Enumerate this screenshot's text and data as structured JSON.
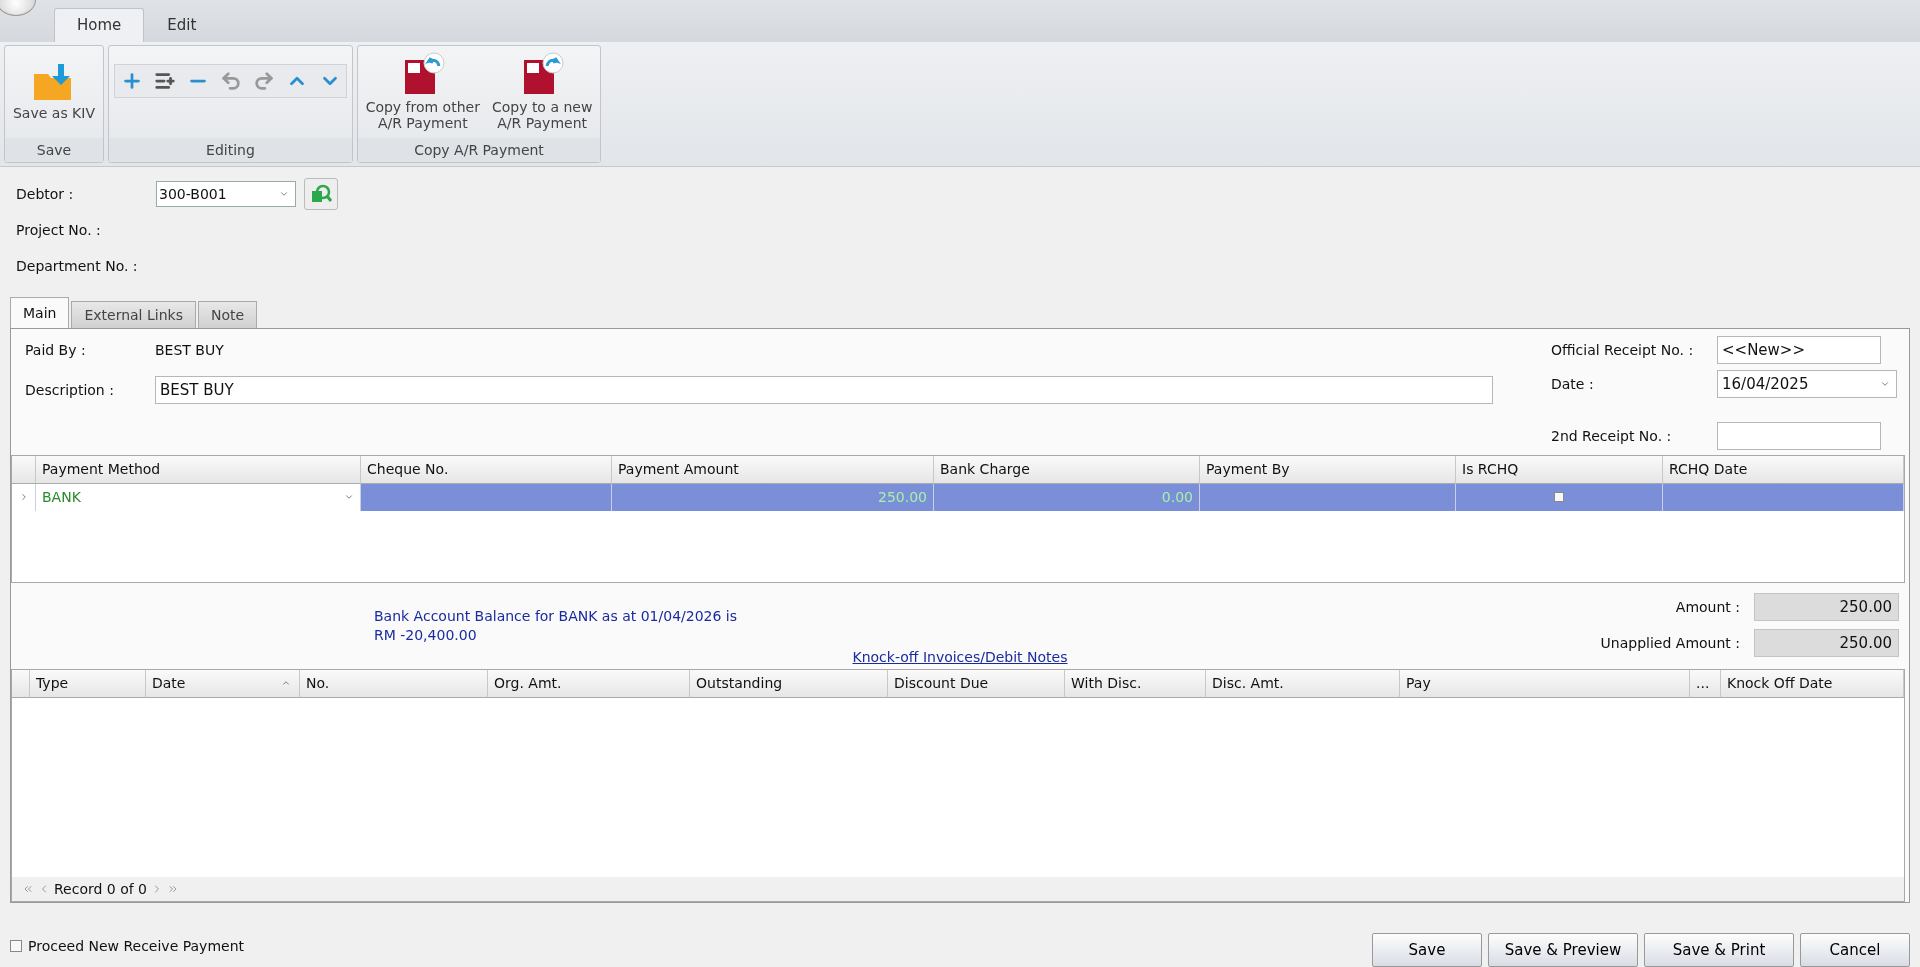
{
  "ribbon": {
    "tabs": [
      {
        "label": "Home",
        "selected": true
      },
      {
        "label": "Edit",
        "selected": false
      }
    ],
    "groups": [
      {
        "label": "Save",
        "kind": "save",
        "buttons": [
          {
            "label": "Save as KIV"
          }
        ]
      },
      {
        "label": "Editing",
        "kind": "editing"
      },
      {
        "label": "Copy A/R Payment",
        "kind": "copy",
        "buttons": [
          {
            "label": "Copy from other\nA/R Payment"
          },
          {
            "label": "Copy to a new\nA/R Payment"
          }
        ]
      }
    ]
  },
  "header": {
    "debtor_label": "Debtor :",
    "debtor_value": "300-B001",
    "project_label": "Project No. :",
    "department_label": "Department No. :"
  },
  "tabs": [
    {
      "label": "Main",
      "selected": true
    },
    {
      "label": "External Links",
      "selected": false
    },
    {
      "label": "Note",
      "selected": false
    }
  ],
  "main": {
    "paid_by_label": "Paid By :",
    "paid_by_value": "BEST BUY",
    "description_label": "Description :",
    "description_value": "BEST BUY",
    "receipt_label": "Official Receipt No. :",
    "receipt_value": "<<New>>",
    "date_label": "Date :",
    "date_value": "16/04/2025",
    "second_receipt_label": "2nd Receipt No. :"
  },
  "payment_grid": {
    "columns": [
      "Payment Method",
      "Cheque No.",
      "Payment Amount",
      "Bank Charge",
      "Payment By",
      "Is RCHQ",
      "RCHQ Date"
    ],
    "rows": [
      {
        "method": "BANK",
        "amount": "250.00",
        "bank_charge": "0.00",
        "is_rchq": false,
        "selected": true
      }
    ]
  },
  "balance_text": [
    "Bank Account Balance for BANK as at 01/04/2026 is",
    "RM -20,400.00"
  ],
  "totals": [
    {
      "label": "Amount :",
      "value": "250.00"
    },
    {
      "label": "Unapplied Amount :",
      "value": "250.00"
    }
  ],
  "knockoff": {
    "title": "Knock-off Invoices/Debit Notes",
    "columns": [
      "Type",
      "Date",
      "No.",
      "Org. Amt.",
      "Outstanding",
      "Discount Due",
      "With Disc.",
      "Disc. Amt.",
      "Pay",
      "...",
      "Knock Off Date"
    ],
    "record": "Record 0 of 0"
  },
  "proceed": {
    "label": "Proceed New Receive Payment",
    "checked": false
  },
  "buttons": [
    "Save",
    "Save & Preview",
    "Save & Print",
    "Cancel"
  ]
}
